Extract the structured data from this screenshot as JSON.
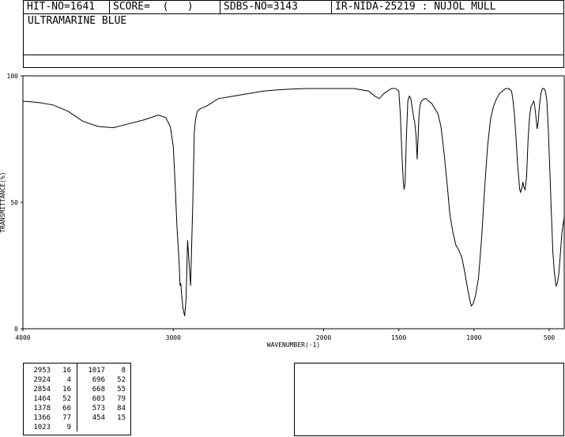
{
  "header": {
    "hit_no": "HIT-NO=1641",
    "score": "SCORE=  (   )",
    "sdbs_no": "SDBS-NO=3143",
    "ir_id": "IR-NIDA-25219 : NUJOL MULL",
    "compound": "ULTRAMARINE BLUE"
  },
  "chart_data": {
    "type": "line",
    "xlabel": "WAVENUMBER(-1)",
    "ylabel": "TRANSMITTANCE(%)",
    "xlim": [
      4000,
      400
    ],
    "ylim": [
      0,
      100
    ],
    "x_ticks": [
      4000,
      3000,
      2000,
      1500,
      1000,
      500
    ],
    "y_ticks": [
      0,
      50,
      100
    ],
    "grid": false,
    "series": [
      {
        "x": [
          4000,
          3900,
          3800,
          3700,
          3600,
          3500,
          3400,
          3300,
          3200,
          3100,
          3050,
          3020,
          3000,
          2990,
          2975,
          2960,
          2955,
          2950,
          2945,
          2935,
          2924,
          2915,
          2905,
          2895,
          2885,
          2870,
          2860,
          2854,
          2848,
          2840,
          2820,
          2780,
          2700,
          2600,
          2500,
          2400,
          2300,
          2200,
          2100,
          2000,
          1900,
          1800,
          1700,
          1660,
          1630,
          1600,
          1550,
          1520,
          1500,
          1490,
          1480,
          1470,
          1464,
          1458,
          1450,
          1440,
          1430,
          1420,
          1410,
          1400,
          1395,
          1385,
          1378,
          1372,
          1366,
          1360,
          1355,
          1350,
          1340,
          1330,
          1320,
          1300,
          1280,
          1260,
          1240,
          1220,
          1200,
          1180,
          1160,
          1140,
          1120,
          1100,
          1080,
          1060,
          1040,
          1023,
          1017,
          1005,
          990,
          970,
          950,
          930,
          910,
          890,
          870,
          850,
          830,
          810,
          790,
          770,
          750,
          740,
          730,
          720,
          710,
          700,
          696,
          690,
          680,
          675,
          668,
          660,
          650,
          640,
          630,
          620,
          610,
          603,
          598,
          590,
          580,
          573,
          565,
          555,
          545,
          535,
          525,
          515,
          505,
          495,
          485,
          475,
          465,
          454,
          445,
          435,
          425,
          415,
          405,
          400
        ],
        "y": [
          90,
          89.5,
          88.5,
          86,
          82,
          80,
          79.5,
          81,
          82.5,
          84.5,
          83.5,
          80,
          72,
          60,
          40,
          25,
          17,
          18,
          14,
          8,
          5,
          12,
          35,
          26,
          17,
          50,
          78,
          82,
          84,
          86,
          87,
          88,
          91,
          92,
          93,
          94,
          94.5,
          94.8,
          95,
          95,
          95,
          95,
          94,
          92,
          91,
          93,
          95,
          95,
          94,
          85,
          70,
          58,
          55,
          58,
          75,
          90,
          92,
          91,
          87,
          83,
          82,
          76,
          67,
          75,
          84,
          88,
          89,
          90,
          90.5,
          91,
          91,
          90,
          89,
          87,
          85,
          80,
          70,
          58,
          45,
          38,
          33,
          31,
          28,
          22,
          15,
          10,
          9,
          10,
          13,
          20,
          35,
          55,
          72,
          83,
          88,
          91,
          93,
          94,
          95,
          95,
          94,
          90,
          84,
          75,
          65,
          58,
          55,
          54,
          56,
          58,
          56,
          55,
          60,
          75,
          84,
          88,
          89,
          90,
          89,
          85,
          79,
          82,
          88,
          93,
          95,
          95,
          94,
          90,
          78,
          62,
          45,
          30,
          22,
          17,
          18,
          22,
          30,
          38,
          42,
          44
        ]
      }
    ]
  },
  "peaks": {
    "col1": [
      {
        "wn": "2953",
        "t": "16"
      },
      {
        "wn": "2924",
        "t": "4"
      },
      {
        "wn": "2854",
        "t": "16"
      },
      {
        "wn": "1464",
        "t": "52"
      },
      {
        "wn": "1378",
        "t": "66"
      },
      {
        "wn": "1366",
        "t": "77"
      },
      {
        "wn": "1023",
        "t": "9"
      }
    ],
    "col2": [
      {
        "wn": "1017",
        "t": "8"
      },
      {
        "wn": "696",
        "t": "52"
      },
      {
        "wn": "668",
        "t": "55"
      },
      {
        "wn": "603",
        "t": "79"
      },
      {
        "wn": "573",
        "t": "84"
      },
      {
        "wn": "454",
        "t": "15"
      }
    ]
  }
}
